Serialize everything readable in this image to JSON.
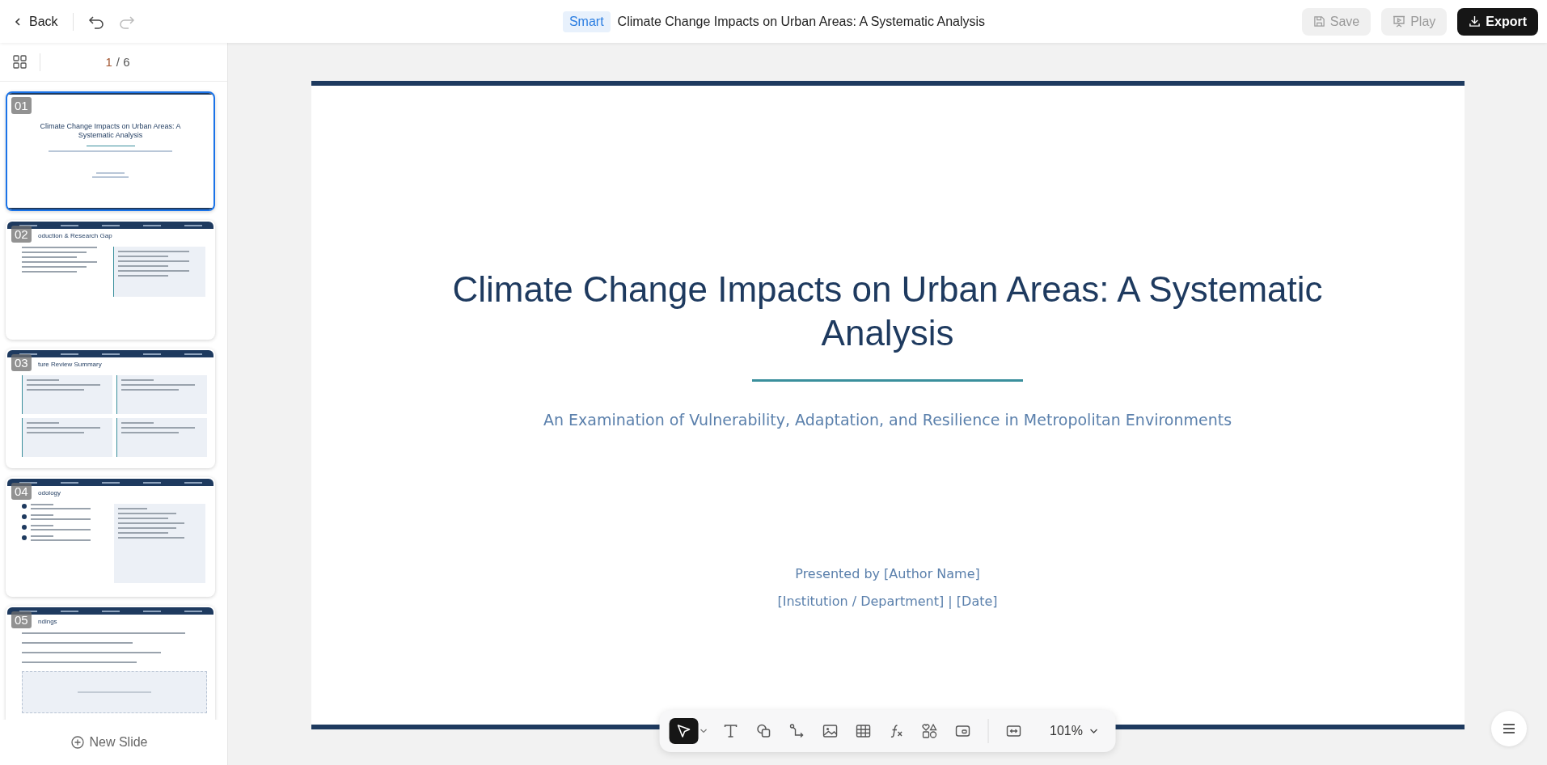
{
  "topbar": {
    "back": "Back",
    "badge": "Smart",
    "title": "Climate Change Impacts on Urban Areas: A Systematic Analysis",
    "buttons": [
      {
        "kind": "save",
        "label": "Save",
        "disabled": true
      },
      {
        "kind": "play",
        "label": "Play",
        "disabled": true
      },
      {
        "kind": "export",
        "label": "Export",
        "disabled": false
      }
    ]
  },
  "sidebar": {
    "page": {
      "current": "1",
      "rest": "/ 6"
    },
    "slides": [
      {
        "number": "01",
        "kind": "title",
        "selected": true,
        "heading": "Climate Change Impacts on Urban Areas: A Systematic Analysis"
      },
      {
        "number": "02",
        "kind": "two_column",
        "selected": false,
        "heading": "oduction & Research Gap"
      },
      {
        "number": "03",
        "kind": "grid",
        "selected": false,
        "heading": "ture Review Summary"
      },
      {
        "number": "04",
        "kind": "steps",
        "selected": false,
        "heading": "odology"
      },
      {
        "number": "05",
        "kind": "findings",
        "selected": false,
        "heading": "ndings"
      }
    ],
    "new_slide": "New Slide"
  },
  "slide": {
    "title": "Climate Change Impacts on Urban Areas: A Systematic Analysis",
    "subtitle": "An Examination of Vulnerability, Adaptation, and Resilience in Metropolitan Environments",
    "presenter": "Presented by [Author Name]",
    "institution": "[Institution / Department] | [Date]"
  },
  "toolbar": {
    "tools": [
      {
        "kind": "select",
        "selected": true
      },
      {
        "kind": "text",
        "selected": false
      },
      {
        "kind": "shape",
        "selected": false
      },
      {
        "kind": "connector",
        "selected": false
      },
      {
        "kind": "image",
        "selected": false
      },
      {
        "kind": "table",
        "selected": false
      },
      {
        "kind": "formula",
        "selected": false
      },
      {
        "kind": "elements",
        "selected": false
      },
      {
        "kind": "media",
        "selected": false
      },
      {
        "kind": "fit",
        "selected": false
      }
    ],
    "zoom": "101%"
  }
}
